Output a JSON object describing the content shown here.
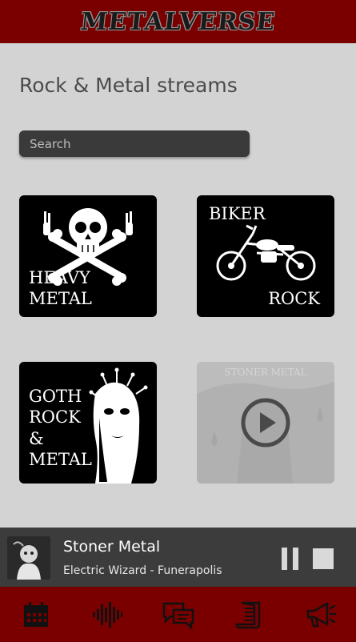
{
  "header": {
    "logo": "METALVERSE"
  },
  "page": {
    "title": "Rock & Metal streams"
  },
  "search": {
    "placeholder": "Search",
    "value": ""
  },
  "genres": [
    {
      "label": "HEAVY METAL",
      "icon": "skull-icon"
    },
    {
      "label_top": "BIKER",
      "label_bottom": "ROCK",
      "icon": "motorcycle-icon"
    },
    {
      "label": "GOTH ROCK & METAL",
      "icon": "goth-face-icon"
    },
    {
      "label": "STONER METAL",
      "icon": "play-icon",
      "state": "now-playing"
    }
  ],
  "player": {
    "track": "Stoner Metal",
    "artist": "Electric Wizard - Funerapolis",
    "cover_icon": "album-cover-icon",
    "controls": [
      "pause-icon",
      "stop-icon"
    ]
  },
  "bottom_nav": [
    "calendar-icon",
    "waveform-icon",
    "chat-icon",
    "scroll-icon",
    "megaphone-icon"
  ],
  "colors": {
    "header_bg": "#7a0000",
    "body_bg": "#d3d3d3",
    "player_bg": "#3c3c3c",
    "tile_bg": "#000000"
  }
}
